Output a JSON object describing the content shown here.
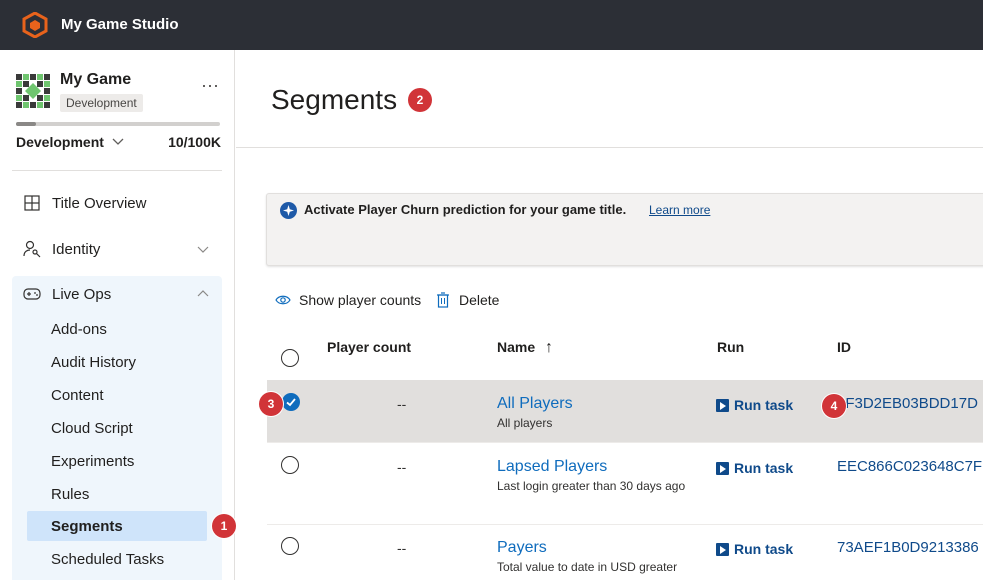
{
  "app": {
    "title": "My Game Studio"
  },
  "sidebar": {
    "game_name": "My Game",
    "game_env_badge": "Development",
    "more_label": "···",
    "environment_selector": "Development",
    "usage_text": "10/100K",
    "usage_fraction": 0.1,
    "items": [
      {
        "label": "Title Overview",
        "icon": "grid-icon"
      },
      {
        "label": "Identity",
        "icon": "person-key-icon"
      },
      {
        "label": "Live Ops",
        "icon": "gamepad-icon"
      }
    ],
    "live_ops_items": [
      {
        "label": "Add-ons"
      },
      {
        "label": "Audit History"
      },
      {
        "label": "Content"
      },
      {
        "label": "Cloud Script"
      },
      {
        "label": "Experiments"
      },
      {
        "label": "Rules"
      },
      {
        "label": "Segments"
      },
      {
        "label": "Scheduled Tasks"
      }
    ]
  },
  "page": {
    "title": "Segments"
  },
  "banner": {
    "text": "Activate Player Churn prediction for your game title.",
    "link": "Learn more"
  },
  "toolbar": {
    "show_counts": "Show player counts",
    "delete": "Delete"
  },
  "table": {
    "headers": {
      "count": "Player count",
      "name": "Name",
      "name_sort": "↑",
      "run": "Run",
      "id": "ID"
    },
    "rows": [
      {
        "count": "--",
        "name": "All Players",
        "description": "All players",
        "run": "Run task",
        "id": "1F3D2EB03BDD17D",
        "selected": true
      },
      {
        "count": "--",
        "name": "Lapsed Players",
        "description": "Last login greater than 30 days ago",
        "run": "Run task",
        "id": "EEC866C023648C7F",
        "selected": false
      },
      {
        "count": "--",
        "name": "Payers",
        "description": "Total value to date in USD greater",
        "run": "Run task",
        "id": "73AEF1B0D9213386",
        "selected": false
      }
    ]
  },
  "annotations": [
    "1",
    "2",
    "3",
    "4"
  ],
  "colors": {
    "topbar": "#2c2f36",
    "accent": "#0f6cbd",
    "badge": "#d13438",
    "logo": "#e8631c"
  }
}
